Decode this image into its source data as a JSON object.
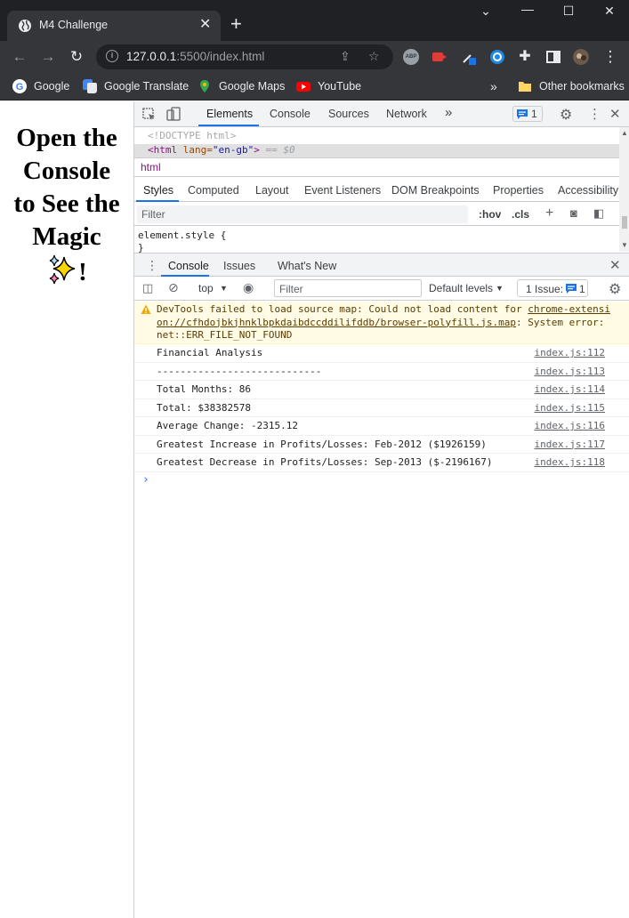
{
  "browser": {
    "tab_title": "M4 Challenge",
    "url_host": "127.0.0.1",
    "url_path": ":5500/index.html",
    "bookmarks": [
      {
        "label": "Google",
        "icon": "google-icon"
      },
      {
        "label": "Google Translate",
        "icon": "translate-icon"
      },
      {
        "label": "Google Maps",
        "icon": "maps-icon"
      },
      {
        "label": "YouTube",
        "icon": "youtube-icon"
      }
    ],
    "bookmarks_overflow": "»",
    "other_bookmarks": "Other bookmarks",
    "ext_abp": "ABP"
  },
  "page": {
    "line1": "Open the",
    "line2": "Console",
    "line3": "to See the",
    "line4": "Magic",
    "suffix": "!"
  },
  "devtools": {
    "main_tabs": [
      "Elements",
      "Console",
      "Sources",
      "Network"
    ],
    "more_tabs": "»",
    "issues_count": "1",
    "dom_doctype": "<!DOCTYPE html>",
    "dom_html_tag": "<html",
    "dom_lang_attr": " lang=",
    "dom_lang_val": "\"en-gb\"",
    "dom_html_close": ">",
    "dom_eq": " == $0",
    "breadcrumb": "html",
    "sub_tabs": [
      "Styles",
      "Computed",
      "Layout",
      "Event Listeners",
      "DOM Breakpoints",
      "Properties",
      "Accessibility"
    ],
    "styles_filter_placeholder": "Filter",
    "hov": ":hov",
    "cls": ".cls",
    "element_style": "element.style {",
    "element_style_close": "}",
    "drawer_tabs": [
      "Console",
      "Issues",
      "What's New"
    ],
    "console": {
      "context": "top",
      "filter_placeholder": "Filter",
      "levels": "Default levels",
      "issue_label": "1 Issue:",
      "issue_count": "1",
      "warning": {
        "prefix": "DevTools failed to load source map: Could not load content for ",
        "link": "chrome-extension://cfhdojbkjhnklbpkdaibdccddilifddb/browser-polyfill.js.map",
        "suffix": ": System error: net::ERR_FILE_NOT_FOUND"
      },
      "logs": [
        {
          "msg": "Financial Analysis",
          "src": "index.js:112"
        },
        {
          "msg": "----------------------------",
          "src": "index.js:113"
        },
        {
          "msg": "Total Months: 86",
          "src": "index.js:114"
        },
        {
          "msg": "Total: $38382578",
          "src": "index.js:115"
        },
        {
          "msg": "Average Change: -2315.12",
          "src": "index.js:116"
        },
        {
          "msg": "Greatest Increase in Profits/Losses: Feb-2012 ($1926159)",
          "src": "index.js:117"
        },
        {
          "msg": "Greatest Decrease in Profits/Losses: Sep-2013 ($-2196167)",
          "src": "index.js:118"
        }
      ],
      "prompt": "›"
    }
  }
}
